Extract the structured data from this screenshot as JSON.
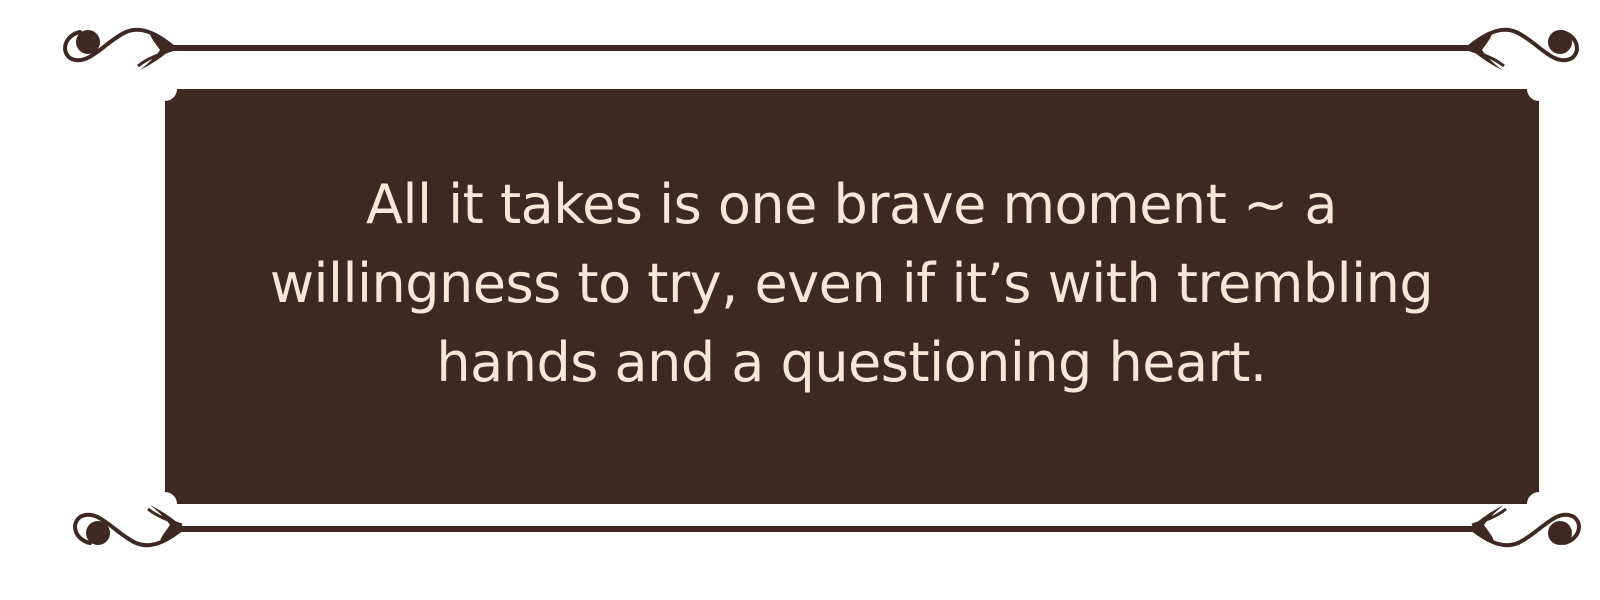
{
  "quote": {
    "text": "All it takes is one brave moment ~ a willingness to try, even if it’s with trembling hands and a questioning heart."
  },
  "colors": {
    "panel": "#3f2824",
    "frame": "#3f2824",
    "text": "#f7e7d8",
    "background": "#ffffff"
  },
  "decorations": {
    "corner_ornament": "scroll-flourish",
    "border_style": "double-line-with-notched-panel"
  }
}
